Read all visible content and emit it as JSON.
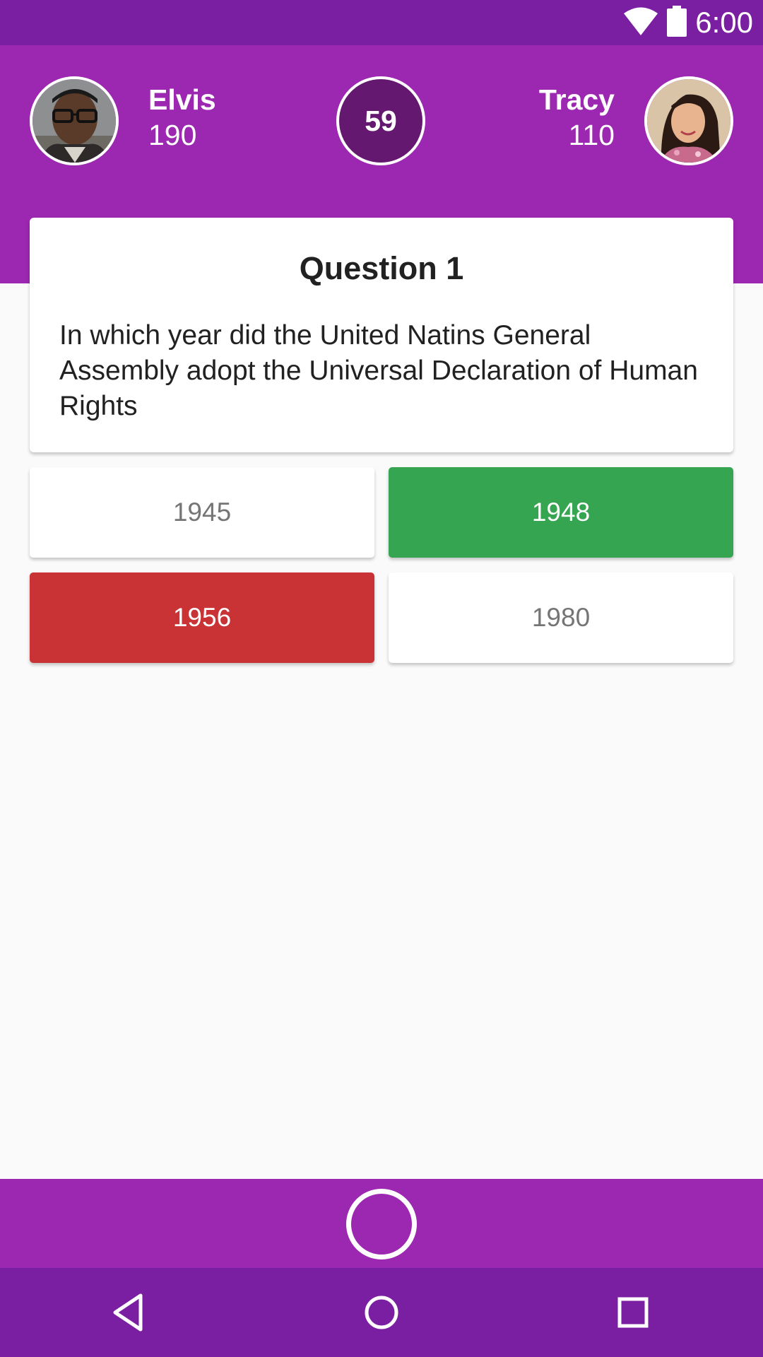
{
  "status_bar": {
    "time": "6:00",
    "icons": [
      "wifi-icon",
      "battery-icon"
    ]
  },
  "players": {
    "left": {
      "name": "Elvis",
      "score": "190",
      "avatar": "avatar-elvis"
    },
    "right": {
      "name": "Tracy",
      "score": "110",
      "avatar": "avatar-tracy"
    }
  },
  "timer": {
    "value": "59"
  },
  "question": {
    "title": "Question 1",
    "text": "In which year did the United Natins General Assembly adopt the Universal Declaration of Human Rights"
  },
  "answers": [
    {
      "label": "1945",
      "state": "neutral"
    },
    {
      "label": "1948",
      "state": "correct"
    },
    {
      "label": "1956",
      "state": "wrong"
    },
    {
      "label": "1980",
      "state": "neutral"
    }
  ],
  "bottom_bar": {
    "icon": "ring-button-icon"
  },
  "nav_bar": {
    "icons": [
      "back-icon",
      "home-icon",
      "recents-icon"
    ]
  },
  "colors": {
    "primary": "#9c27b0",
    "primary_dark": "#7b1fa2",
    "timer_bg": "#64186f",
    "correct": "#36a551",
    "wrong": "#c93335",
    "background": "#fafafa"
  }
}
